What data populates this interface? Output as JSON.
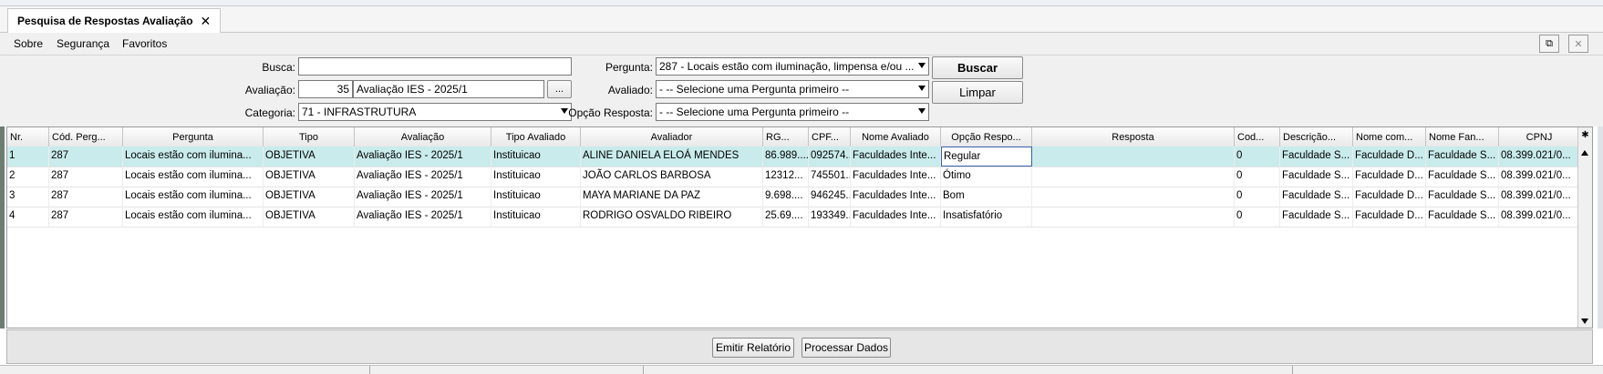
{
  "tab": {
    "title": "Pesquisa de Respostas Avaliação",
    "close": "✕"
  },
  "menu": {
    "items": [
      "Sobre",
      "Segurança",
      "Favoritos"
    ]
  },
  "window_buttons": {
    "popout": "⧉",
    "close": "✕"
  },
  "form": {
    "busca_label": "Busca:",
    "busca_value": "",
    "avaliacao_label": "Avaliação:",
    "avaliacao_code": "35",
    "avaliacao_name": "Avaliação IES - 2025/1",
    "lookup_button": "...",
    "categoria_label": "Categoria:",
    "categoria_value": "71 - INFRASTRUTURA",
    "pergunta_label": "Pergunta:",
    "pergunta_value": "287 - Locais estão com iluminação, limpensa e/ou ...",
    "avaliado_label": "Avaliado:",
    "avaliado_value": "- -- Selecione uma Pergunta primeiro --",
    "opcao_label": "Opção Resposta:",
    "opcao_value": "- -- Selecione uma Pergunta primeiro --",
    "buscar_button": "Buscar",
    "limpar_button": "Limpar"
  },
  "grid": {
    "headers": [
      "Nr.",
      "Cód. Perg...",
      "Pergunta",
      "Tipo",
      "Avaliação",
      "Tipo Avaliado",
      "Avaliador",
      "RG...",
      "CPF...",
      "Nome Avaliado",
      "Opção Respo...",
      "Resposta",
      "Cod...",
      "Descrição...",
      "Nome com...",
      "Nome Fan...",
      "CPNJ"
    ],
    "settings_icon": "✱",
    "rows": [
      [
        "1",
        "287",
        "Locais estão com ilumina...",
        "OBJETIVA",
        "Avaliação IES - 2025/1",
        "Instituicao",
        "ALINE DANIELA ELOÁ MENDES",
        "86.989....",
        "092574...",
        "Faculdades Inte...",
        "Regular",
        "",
        "0",
        "Faculdade S...",
        "Faculdade D...",
        "Faculdade S...",
        "08.399.021/0..."
      ],
      [
        "2",
        "287",
        "Locais estão com ilumina...",
        "OBJETIVA",
        "Avaliação IES - 2025/1",
        "Instituicao",
        "JOÃO CARLOS BARBOSA",
        "12312...",
        "745501...",
        "Faculdades Inte...",
        "Ótimo",
        "",
        "0",
        "Faculdade S...",
        "Faculdade D...",
        "Faculdade S...",
        "08.399.021/0..."
      ],
      [
        "3",
        "287",
        "Locais estão com ilumina...",
        "OBJETIVA",
        "Avaliação IES - 2025/1",
        "Instituicao",
        "MAYA MARIANE DA PAZ",
        "9.698....",
        "946245...",
        "Faculdades Inte...",
        "Bom",
        "",
        "0",
        "Faculdade S...",
        "Faculdade D...",
        "Faculdade S...",
        "08.399.021/0..."
      ],
      [
        "4",
        "287",
        "Locais estão com ilumina...",
        "OBJETIVA",
        "Avaliação IES - 2025/1",
        "Instituicao",
        "RODRIGO OSVALDO RIBEIRO",
        "25.69....",
        "193349...",
        "Faculdades Inte...",
        "Insatisfatório",
        "",
        "0",
        "Faculdade S...",
        "Faculdade D...",
        "Faculdade S...",
        "08.399.021/0..."
      ]
    ]
  },
  "footer": {
    "emitir_button": "Emitir Relatório",
    "processar_button": "Processar Dados"
  }
}
